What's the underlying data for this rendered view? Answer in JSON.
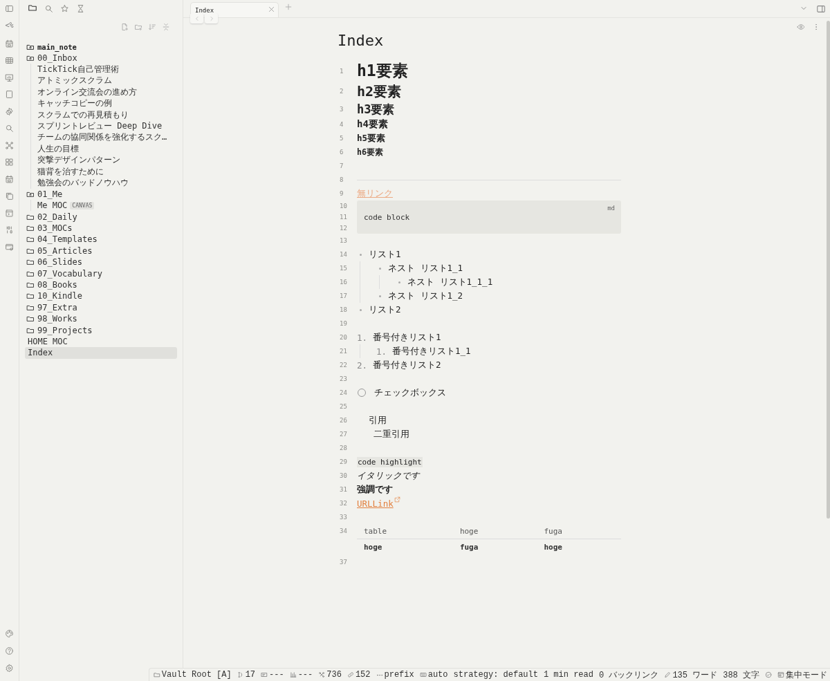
{
  "ribbon": {
    "template_label": "<%"
  },
  "tab": {
    "title": "Index"
  },
  "sidebar": {
    "vault": "main_note",
    "tree": [
      {
        "label": "00_Inbox",
        "kind": "folder",
        "expanded": true,
        "selected": false,
        "children": [
          {
            "label": "TickTick自己管理術",
            "kind": "file",
            "selected": false
          },
          {
            "label": "アトミックスクラム",
            "kind": "file",
            "selected": false
          },
          {
            "label": "オンライン交流会の進め方",
            "kind": "file",
            "selected": false
          },
          {
            "label": "キャッチコピーの例",
            "kind": "file",
            "selected": false
          },
          {
            "label": "スクラムでの再見積もり",
            "kind": "file",
            "selected": false
          },
          {
            "label": "スプリントレビュー Deep Dive",
            "kind": "file",
            "selected": false
          },
          {
            "label": "チームの協同関係を強化するスク…",
            "kind": "file",
            "selected": false
          },
          {
            "label": "人生の目標",
            "kind": "file",
            "selected": false
          },
          {
            "label": "突撃デザインパターン",
            "kind": "file",
            "selected": false
          },
          {
            "label": "猫背を治すために",
            "kind": "file",
            "selected": false
          },
          {
            "label": "勉強会のバッドノウハウ",
            "kind": "file",
            "selected": false
          }
        ]
      },
      {
        "label": "01_Me",
        "kind": "folder",
        "expanded": true,
        "selected": false,
        "children": [
          {
            "label": "Me MOC",
            "kind": "file",
            "badge": "CANVAS",
            "selected": false
          }
        ]
      },
      {
        "label": "02_Daily",
        "kind": "folder",
        "expanded": false,
        "selected": false
      },
      {
        "label": "03_MOCs",
        "kind": "folder",
        "expanded": false,
        "selected": false
      },
      {
        "label": "04_Templates",
        "kind": "folder",
        "expanded": false,
        "selected": false
      },
      {
        "label": "05_Articles",
        "kind": "folder",
        "expanded": false,
        "selected": false
      },
      {
        "label": "06_Slides",
        "kind": "folder",
        "expanded": false,
        "selected": false
      },
      {
        "label": "07_Vocabulary",
        "kind": "folder",
        "expanded": false,
        "selected": false
      },
      {
        "label": "08_Books",
        "kind": "folder",
        "expanded": false,
        "selected": false
      },
      {
        "label": "10_Kindle",
        "kind": "folder",
        "expanded": false,
        "selected": false
      },
      {
        "label": "97_Extra",
        "kind": "folder",
        "expanded": false,
        "selected": false
      },
      {
        "label": "98_Works",
        "kind": "folder",
        "expanded": false,
        "selected": false
      },
      {
        "label": "99_Projects",
        "kind": "folder",
        "expanded": false,
        "selected": false
      },
      {
        "label": "HOME MOC",
        "kind": "file",
        "selected": false
      },
      {
        "label": "Index",
        "kind": "file",
        "selected": true
      }
    ]
  },
  "editor": {
    "title": "Index",
    "blocks": [
      {
        "kind": "h1",
        "n": "1",
        "text": "h1要素"
      },
      {
        "kind": "h2",
        "n": "2",
        "text": "h2要素"
      },
      {
        "kind": "h3",
        "n": "3",
        "text": "h3要素"
      },
      {
        "kind": "h4",
        "n": "4",
        "text": "h4要素"
      },
      {
        "kind": "h5",
        "n": "5",
        "text": "h5要素"
      },
      {
        "kind": "h6",
        "n": "6",
        "text": "h6要素"
      },
      {
        "kind": "blank",
        "n": "7"
      },
      {
        "kind": "hr",
        "n": "8"
      },
      {
        "kind": "link",
        "n": "9",
        "text": "無リンク"
      },
      {
        "kind": "code",
        "lines": [
          "10",
          "11",
          "12"
        ],
        "lang": "md",
        "code": "code block"
      },
      {
        "kind": "blank",
        "n": "13"
      },
      {
        "kind": "bullets",
        "items": [
          {
            "n": "14",
            "text": "リスト1",
            "children": [
              {
                "n": "15",
                "text": "ネスト リスト1_1",
                "children": [
                  {
                    "n": "16",
                    "text": "ネスト リスト1_1_1"
                  }
                ]
              },
              {
                "n": "17",
                "text": "ネスト リスト1_2"
              }
            ]
          },
          {
            "n": "18",
            "text": "リスト2"
          }
        ]
      },
      {
        "kind": "blank",
        "n": "19"
      },
      {
        "kind": "ordered",
        "items": [
          {
            "n": "20",
            "marker": "1.",
            "text": "番号付きリスト1",
            "children": [
              {
                "n": "21",
                "marker": "1.",
                "text": "番号付きリスト1_1"
              }
            ]
          },
          {
            "n": "22",
            "marker": "2.",
            "text": "番号付きリスト2"
          }
        ]
      },
      {
        "kind": "blank",
        "n": "23"
      },
      {
        "kind": "task",
        "n": "24",
        "text": "チェックボックス",
        "checked": false
      },
      {
        "kind": "blank",
        "n": "25"
      },
      {
        "kind": "quote",
        "n": "26",
        "text": "引用",
        "children": [
          {
            "n": "27",
            "text": "二重引用"
          }
        ]
      },
      {
        "kind": "blank",
        "n": "28"
      },
      {
        "kind": "inline_code",
        "n": "29",
        "text": "code highlight"
      },
      {
        "kind": "italic",
        "n": "30",
        "text": "イタリックです"
      },
      {
        "kind": "bold",
        "n": "31",
        "text": "強調です"
      },
      {
        "kind": "url",
        "n": "32",
        "text": "URLLink"
      },
      {
        "kind": "blank",
        "n": "33"
      },
      {
        "kind": "table",
        "n": "34",
        "columns": [
          "table",
          "hoge",
          "fuga"
        ],
        "rows": [
          [
            "hoge",
            "fuga",
            "hoge"
          ]
        ]
      },
      {
        "kind": "blank",
        "n": "37"
      }
    ]
  },
  "status_bar": [
    {
      "kind": "folder",
      "text": "Vault Root [A]"
    },
    {
      "kind": "cursor",
      "text": "17"
    },
    {
      "kind": "box",
      "text": "---"
    },
    {
      "kind": "bars",
      "text": "---"
    },
    {
      "kind": "nodes",
      "text": "736"
    },
    {
      "kind": "link",
      "text": "152"
    },
    {
      "kind": "dots",
      "text": "prefix"
    },
    {
      "kind": "keyboard",
      "text": "auto"
    },
    {
      "kind": "plain",
      "text": "strategy: default"
    },
    {
      "kind": "plain",
      "text": "1 min read"
    },
    {
      "kind": "plain",
      "text": "0 バックリンク"
    },
    {
      "kind": "pencil",
      "text": "135 ワード"
    },
    {
      "kind": "plain",
      "text": "388 文字"
    },
    {
      "kind": "check"
    },
    {
      "kind": "focus",
      "text": "集中モード"
    }
  ]
}
